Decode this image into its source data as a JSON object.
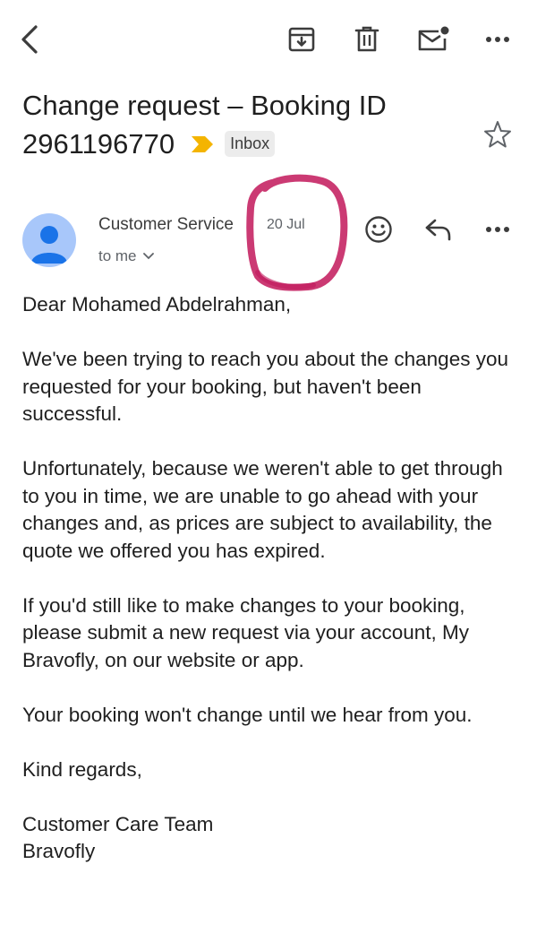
{
  "toolbar": {
    "back_icon": "arrow-left-icon",
    "archive_icon": "archive-icon",
    "delete_icon": "trash-icon",
    "mark_unread_icon": "mail-unread-icon",
    "more_icon": "more-horizontal-icon"
  },
  "email": {
    "subject_line1": "Change request – Booking ID",
    "subject_line2": "2961196770",
    "label": "Inbox",
    "important_color": "#F4B400",
    "sender": "Customer Service",
    "date": "20 Jul",
    "recipient": "to me",
    "body": {
      "greeting": "Dear Mohamed Abdelrahman,",
      "p1": "We've been trying to reach you about the changes you requested for your booking, but haven't been successful.",
      "p2": "Unfortunately, because we weren't able to get through to you in time, we are unable to go ahead with your changes and, as prices are subject to availability, the quote we offered you has expired.",
      "p3": "If you'd still like to make changes to your booking, please submit a new request via your account, My Bravofly, on our website or app.",
      "p4": "Your booking won't change until we hear from you.",
      "closing": "Kind regards,",
      "sig_line1": "Customer Care Team",
      "sig_line2": "Bravofly"
    }
  },
  "annotation_color": "#C2185B"
}
